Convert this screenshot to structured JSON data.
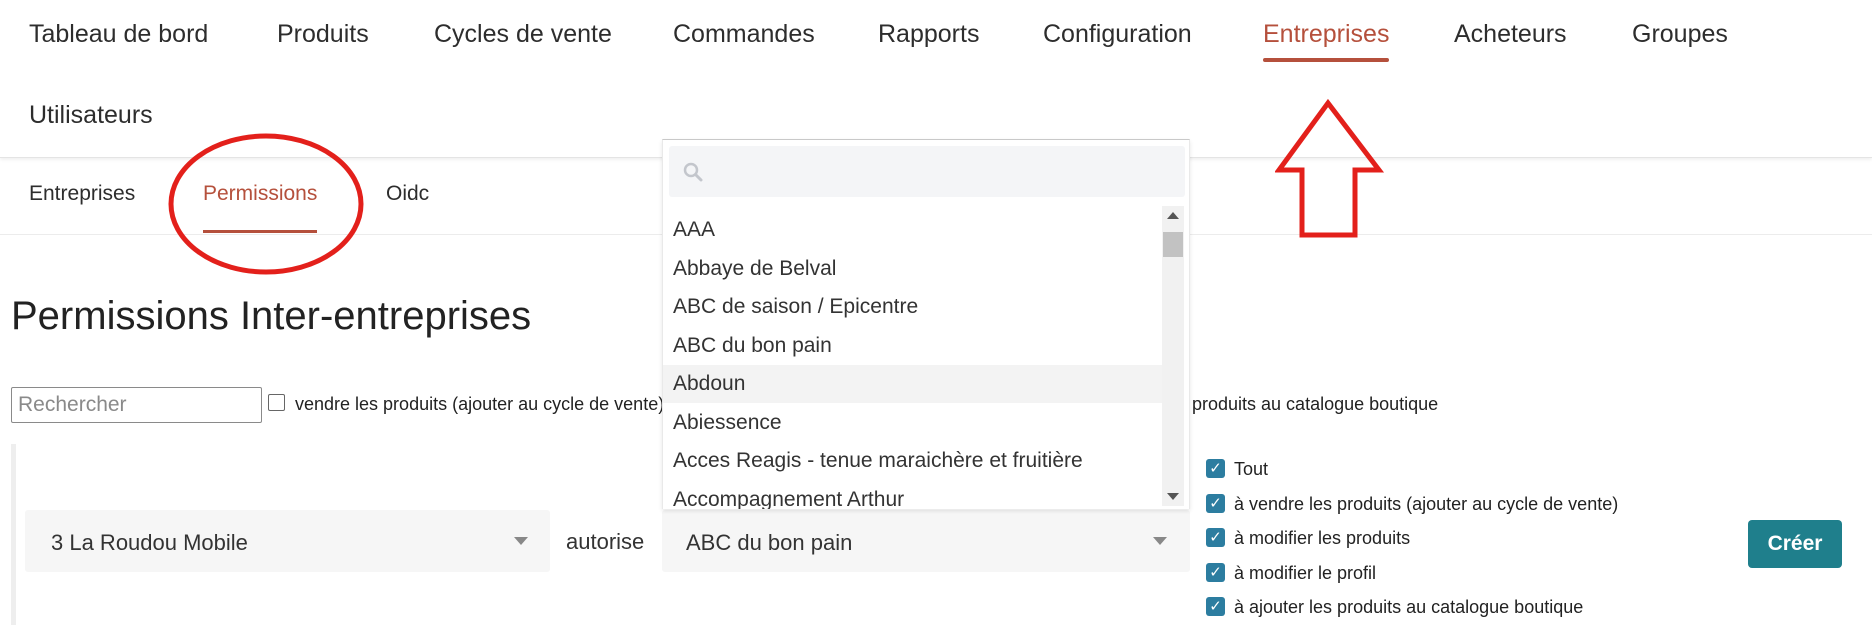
{
  "topnav": {
    "items": [
      {
        "label": "Tableau de bord"
      },
      {
        "label": "Produits"
      },
      {
        "label": "Cycles de vente"
      },
      {
        "label": "Commandes"
      },
      {
        "label": "Rapports"
      },
      {
        "label": "Configuration"
      },
      {
        "label": "Entreprises",
        "active": true
      },
      {
        "label": "Acheteurs"
      },
      {
        "label": "Groupes"
      },
      {
        "label": "Utilisateurs"
      }
    ]
  },
  "subtabs": {
    "items": [
      {
        "label": "Entreprises"
      },
      {
        "label": "Permissions",
        "active": true
      },
      {
        "label": "Oidc"
      }
    ]
  },
  "main": {
    "title": "Permissions Inter-entreprises",
    "search_placeholder": "Rechercher",
    "filter_text_left": "vendre les produits (ajouter au cycle de vente)",
    "filter_text_right": "produits au catalogue boutique",
    "row": {
      "company_from": "3 La Roudou Mobile",
      "autorise_label": "autorise",
      "company_to": "ABC du bon pain",
      "permissions": [
        {
          "label": "Tout",
          "checked": true
        },
        {
          "label": "à vendre les produits (ajouter au cycle de vente)",
          "checked": true
        },
        {
          "label": "à modifier les produits",
          "checked": true
        },
        {
          "label": "à modifier le profil",
          "checked": true
        },
        {
          "label": "à ajouter les produits au catalogue boutique",
          "checked": true
        }
      ],
      "create_label": "Créer"
    }
  },
  "dropdown": {
    "search_value": "",
    "options": [
      "AAA",
      "Abbaye de Belval",
      "ABC de saison / Epicentre",
      "ABC du bon pain",
      "Abdoun",
      "Abiessence",
      "Acces Reagis - tenue maraichère et fruitière",
      "Accompagnement Arthur"
    ],
    "hovered_option": "Abdoun"
  },
  "colors": {
    "accent": "#b5503c",
    "checkbox": "#2c7da0",
    "create_button": "#1f7f8c",
    "annotation": "#e3201b"
  },
  "icons": {
    "search": "search-icon",
    "caret": "chevron-down-icon",
    "check": "check-icon"
  }
}
